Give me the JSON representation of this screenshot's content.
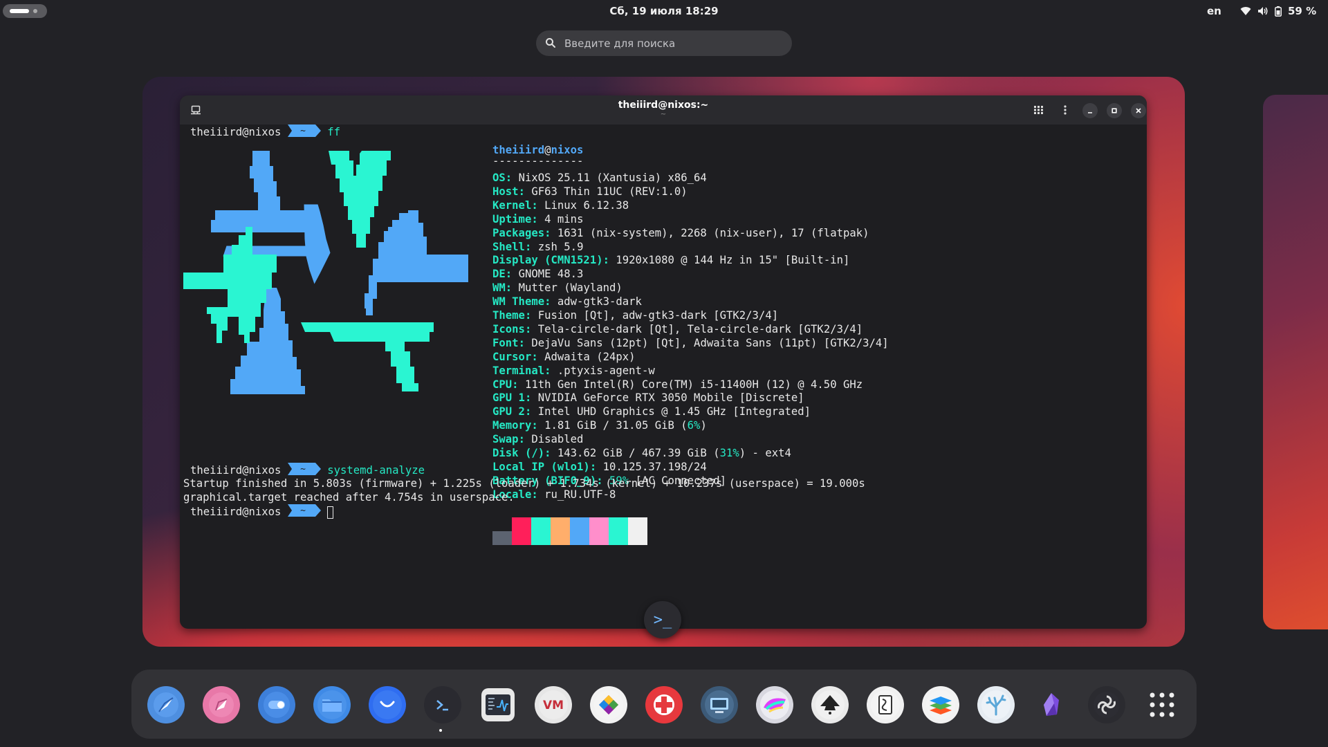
{
  "topbar": {
    "clock": "Сб, 19 июля  18:29",
    "lang": "en",
    "battery": "59 %",
    "icons": [
      "wifi-icon",
      "volume-icon",
      "battery-icon"
    ]
  },
  "search": {
    "placeholder": "Введите для поиска"
  },
  "terminal": {
    "title": "theiiird@nixos:~",
    "subtitle": "~",
    "prompt_user": "theiiird@nixos",
    "prompt_dir": "~",
    "cmd1": "ff",
    "info_user": "theiiird",
    "info_at": "@",
    "info_host": "nixos",
    "info_sep": "--------------",
    "info": [
      {
        "k": "OS",
        "v": "NixOS 25.11 (Xantusia) x86_64"
      },
      {
        "k": "Host",
        "v": "GF63 Thin 11UC (REV:1.0)"
      },
      {
        "k": "Kernel",
        "v": "Linux 6.12.38"
      },
      {
        "k": "Uptime",
        "v": "4 mins"
      },
      {
        "k": "Packages",
        "v": "1631 (nix-system), 2268 (nix-user), 17 (flatpak)"
      },
      {
        "k": "Shell",
        "v": "zsh 5.9"
      },
      {
        "k": "Display (CMN1521)",
        "v": "1920x1080 @ 144 Hz in 15\" [Built-in]"
      },
      {
        "k": "DE",
        "v": "GNOME 48.3"
      },
      {
        "k": "WM",
        "v": "Mutter (Wayland)"
      },
      {
        "k": "WM Theme",
        "v": "adw-gtk3-dark"
      },
      {
        "k": "Theme",
        "v": "Fusion [Qt], adw-gtk3-dark [GTK2/3/4]"
      },
      {
        "k": "Icons",
        "v": "Tela-circle-dark [Qt], Tela-circle-dark [GTK2/3/4]"
      },
      {
        "k": "Font",
        "v": "DejaVu Sans (12pt) [Qt], Adwaita Sans (11pt) [GTK2/3/4]"
      },
      {
        "k": "Cursor",
        "v": "Adwaita (24px)"
      },
      {
        "k": "Terminal",
        "v": ".ptyxis-agent-w"
      },
      {
        "k": "CPU",
        "v": "11th Gen Intel(R) Core(TM) i5-11400H (12) @ 4.50 GHz"
      },
      {
        "k": "GPU 1",
        "v": "NVIDIA GeForce RTX 3050 Mobile [Discrete]"
      },
      {
        "k": "GPU 2",
        "v": "Intel UHD Graphics @ 1.45 GHz [Integrated]"
      },
      {
        "k": "Memory",
        "v": "1.81 GiB / 31.05 GiB (",
        "hl": "6%",
        "post": ")"
      },
      {
        "k": "Swap",
        "v": "Disabled"
      },
      {
        "k": "Disk (/)",
        "v": "143.62 GiB / 467.39 GiB (",
        "hl": "31%",
        "post": ") - ext4"
      },
      {
        "k": "Local IP (wlo1)",
        "v": "10.125.37.198/24"
      },
      {
        "k": "Battery (BIF0_9)",
        "v": "",
        "hl": "59%",
        "post": " [AC Connected]"
      },
      {
        "k": "Locale",
        "v": "ru_RU.UTF-8"
      }
    ],
    "palette": [
      "#5c6370",
      "#ff1f5a",
      "#2af5d2",
      "#ffae6b",
      "#52a8f7",
      "#ff8ecb",
      "#2af5d2",
      "#f0f0f0"
    ],
    "cmd2": "systemd-analyze",
    "out1": "Startup finished in 5.803s (firmware) + 1.225s (loader) + 1.734s (kernel) + 10.237s (userspace) = 19.000s",
    "out2": "graphical.target reached after 4.754s in userspace."
  },
  "colors": {
    "logo_blue": "#52a8f7",
    "logo_cyan": "#2af5d2",
    "accent": "#25e8c4"
  },
  "dock": {
    "apps": [
      "zen-browser",
      "web-browser",
      "toggle-app",
      "files",
      "mail",
      "terminal",
      "system-monitor",
      "virt-manager",
      "color-app",
      "first-aid-app",
      "remote-desktop",
      "krita",
      "inkscape",
      "libreoffice-draw",
      "layers-app",
      "coral-app",
      "obsidian",
      "obs-studio",
      "app-grid"
    ]
  }
}
